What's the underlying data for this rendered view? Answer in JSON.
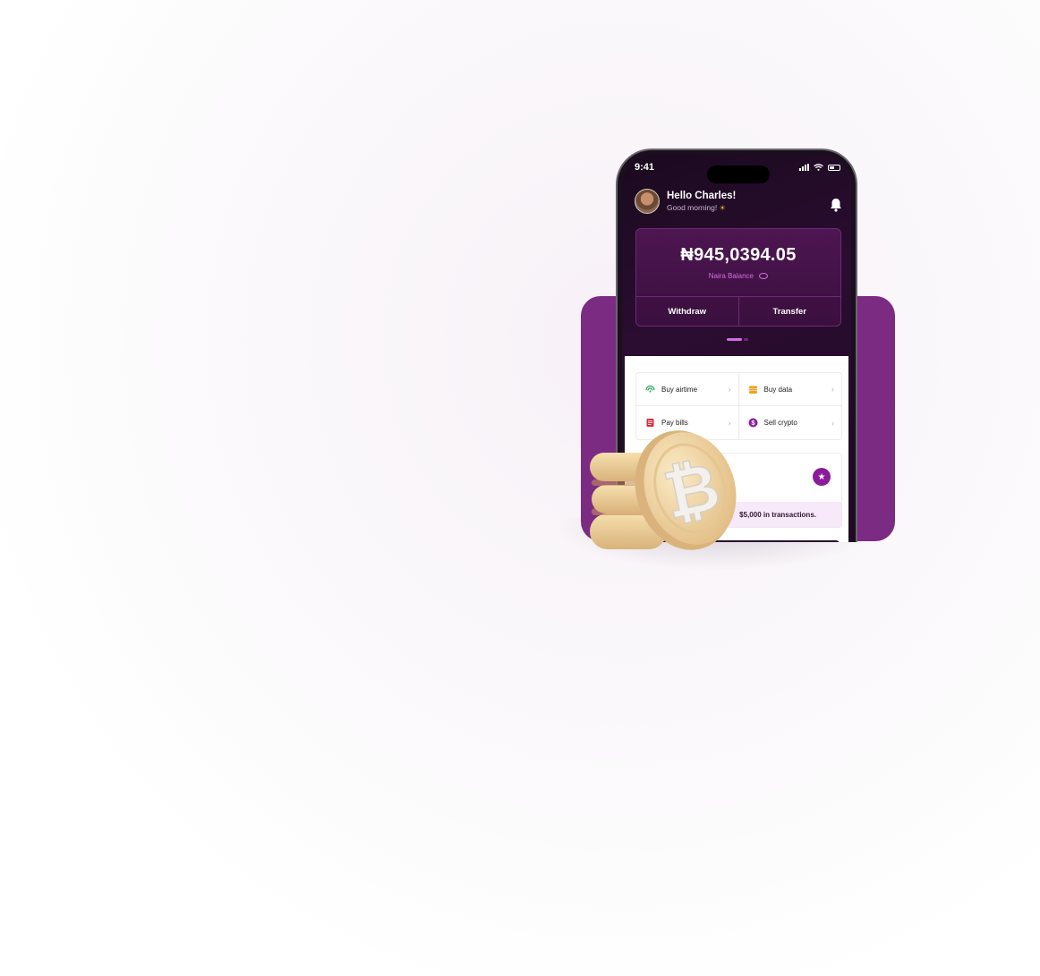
{
  "status_bar": {
    "time": "9:41"
  },
  "header": {
    "greeting": "Hello Charles!",
    "subtitle": "Good morning!",
    "subtitle_emoji": "☀"
  },
  "balance": {
    "amount": "₦945,0394.05",
    "label": "Naira Balance",
    "withdraw_label": "Withdraw",
    "transfer_label": "Transfer"
  },
  "services": [
    {
      "label": "Buy airtime",
      "icon": "signal-icon",
      "color": "#22a35a"
    },
    {
      "label": "Buy data",
      "icon": "data-icon",
      "color": "#f2a11a"
    },
    {
      "label": "Pay bills",
      "icon": "bill-icon",
      "color": "#e2283a"
    },
    {
      "label": "Sell crypto",
      "icon": "dollar-icon",
      "color": "#8a1c9a"
    }
  ],
  "promo": {
    "text": "$5,000 in transactions."
  },
  "colors": {
    "brand": "#7b2c82",
    "accent": "#d070e0",
    "dark": "#1b0a1f"
  }
}
